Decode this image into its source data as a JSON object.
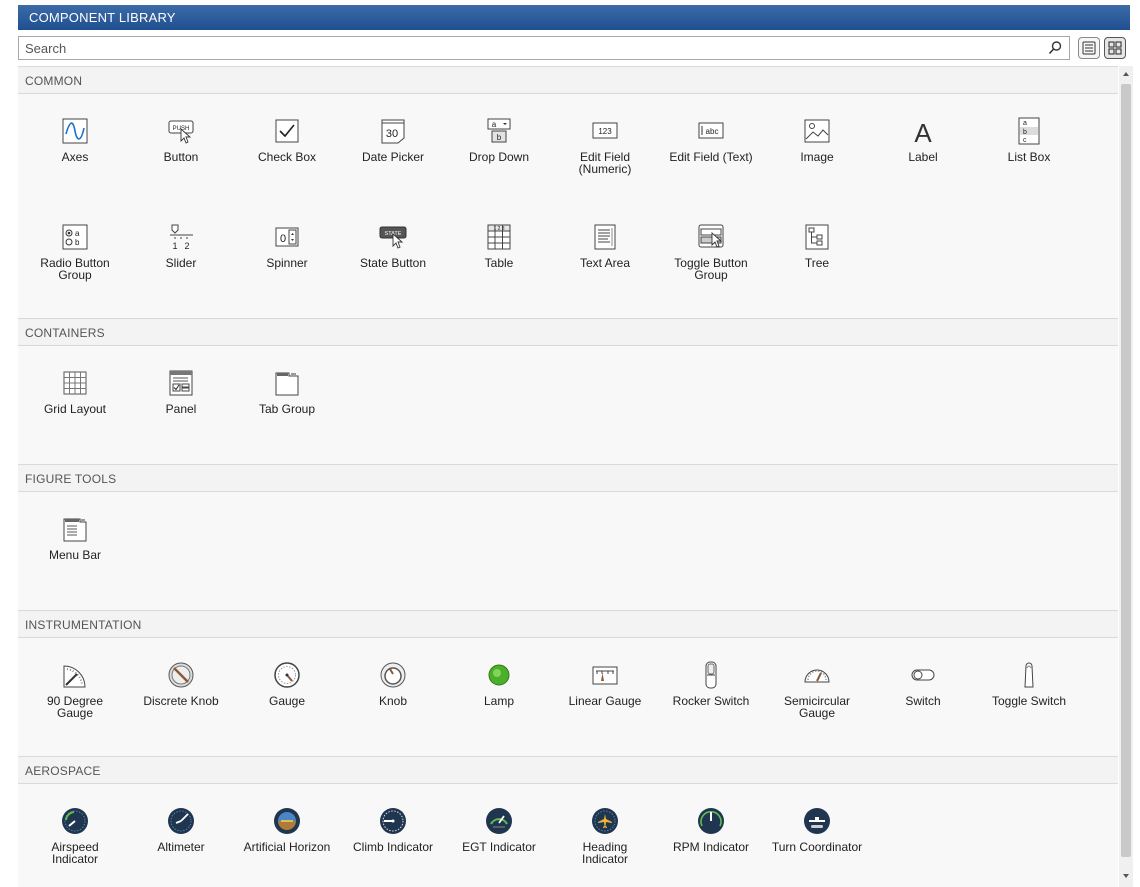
{
  "app": {
    "title": "COMPONENT LIBRARY"
  },
  "search": {
    "placeholder": "Search",
    "value": ""
  },
  "sections": {
    "common": {
      "header": "COMMON",
      "items": [
        {
          "label": "Axes",
          "icon": "axes-icon"
        },
        {
          "label": "Button",
          "icon": "push-button-icon",
          "icon_text": "PUSH"
        },
        {
          "label": "Check Box",
          "icon": "check-box-icon"
        },
        {
          "label": "Date Picker",
          "icon": "date-picker-icon",
          "icon_text": "30"
        },
        {
          "label": "Drop Down",
          "icon": "drop-down-icon",
          "icon_text_a": "a",
          "icon_text_b": "b"
        },
        {
          "label": "Edit Field\n(Numeric)",
          "label_line1": "Edit Field",
          "label_line2": "(Numeric)",
          "icon": "numeric-field-icon",
          "icon_text": "123"
        },
        {
          "label": "Edit Field (Text)",
          "icon": "text-field-icon",
          "icon_text": "abc"
        },
        {
          "label": "Image",
          "icon": "image-icon"
        },
        {
          "label": "Label",
          "icon": "label-icon",
          "icon_text": "A"
        },
        {
          "label": "List Box",
          "icon": "list-box-icon",
          "icon_text_a": "a",
          "icon_text_b": "b",
          "icon_text_c": "c"
        },
        {
          "label_line1": "Radio Button",
          "label_line2": "Group",
          "icon": "radio-group-icon",
          "icon_text_a": "a",
          "icon_text_b": "b"
        },
        {
          "label": "Slider",
          "icon": "slider-icon",
          "icon_text_a": "1",
          "icon_text_b": "2"
        },
        {
          "label": "Spinner",
          "icon": "spinner-icon",
          "icon_text": "0"
        },
        {
          "label": "State Button",
          "icon": "state-button-icon",
          "icon_text": "STATE"
        },
        {
          "label": "Table",
          "icon": "table-icon",
          "icon_text": "1 2 3"
        },
        {
          "label": "Text Area",
          "icon": "text-area-icon"
        },
        {
          "label_line1": "Toggle Button",
          "label_line2": "Group",
          "icon": "toggle-group-icon"
        },
        {
          "label": "Tree",
          "icon": "tree-icon"
        }
      ]
    },
    "containers": {
      "header": "CONTAINERS",
      "items": [
        {
          "label": "Grid Layout",
          "icon": "grid-layout-icon"
        },
        {
          "label": "Panel",
          "icon": "panel-icon"
        },
        {
          "label": "Tab Group",
          "icon": "tab-group-icon"
        }
      ]
    },
    "figure_tools": {
      "header": "FIGURE TOOLS",
      "items": [
        {
          "label": "Menu Bar",
          "icon": "menu-bar-icon"
        }
      ]
    },
    "instrumentation": {
      "header": "INSTRUMENTATION",
      "items": [
        {
          "label_line1": "90 Degree",
          "label_line2": "Gauge",
          "icon": "ninety-degree-gauge-icon"
        },
        {
          "label": "Discrete Knob",
          "icon": "discrete-knob-icon"
        },
        {
          "label": "Gauge",
          "icon": "gauge-icon"
        },
        {
          "label": "Knob",
          "icon": "knob-icon"
        },
        {
          "label": "Lamp",
          "icon": "lamp-icon"
        },
        {
          "label": "Linear Gauge",
          "icon": "linear-gauge-icon"
        },
        {
          "label": "Rocker Switch",
          "icon": "rocker-switch-icon"
        },
        {
          "label_line1": "Semicircular",
          "label_line2": "Gauge",
          "icon": "semicircular-gauge-icon"
        },
        {
          "label": "Switch",
          "icon": "switch-icon"
        },
        {
          "label": "Toggle Switch",
          "icon": "toggle-switch-icon"
        }
      ]
    },
    "aerospace": {
      "header": "AEROSPACE",
      "items": [
        {
          "label_line1": "Airspeed",
          "label_line2": "Indicator",
          "icon": "airspeed-indicator-icon"
        },
        {
          "label": "Altimeter",
          "icon": "altimeter-icon"
        },
        {
          "label": "Artificial Horizon",
          "icon": "artificial-horizon-icon"
        },
        {
          "label": "Climb Indicator",
          "icon": "climb-indicator-icon"
        },
        {
          "label": "EGT Indicator",
          "icon": "egt-indicator-icon"
        },
        {
          "label_line1": "Heading",
          "label_line2": "Indicator",
          "icon": "heading-indicator-icon"
        },
        {
          "label": "RPM Indicator",
          "icon": "rpm-indicator-icon"
        },
        {
          "label": "Turn Coordinator",
          "icon": "turn-coordinator-icon"
        }
      ]
    }
  },
  "view_buttons": {
    "list": "list-view-icon",
    "grid": "grid-view-icon",
    "active": "grid"
  },
  "colors": {
    "title_bar": "#2a5a9a",
    "lamp_green": "#4caf2a",
    "gauge_dark": "#1f3550"
  }
}
